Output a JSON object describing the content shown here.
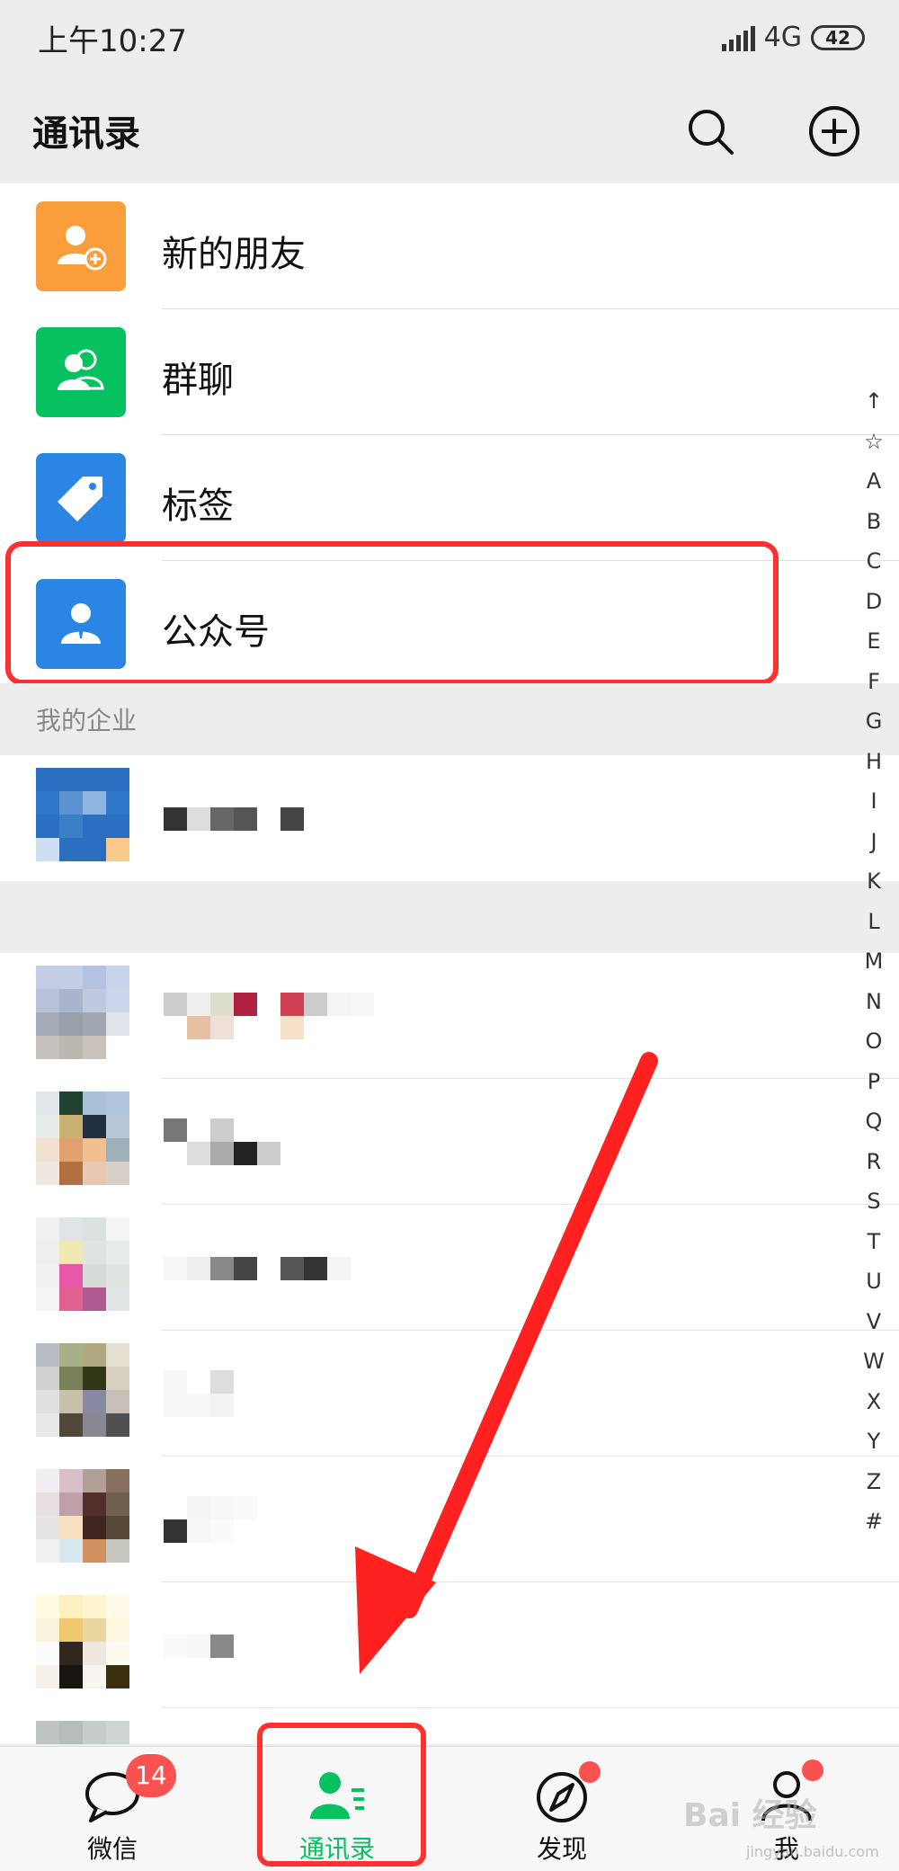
{
  "status_bar": {
    "time": "上午10:27",
    "network": "4G",
    "battery": "42"
  },
  "header": {
    "title": "通讯录",
    "search_icon": "search-icon",
    "add_icon": "plus-circle-icon"
  },
  "menu": [
    {
      "label": "新的朋友",
      "icon": "add-friend-icon",
      "color": "#fa9d3b"
    },
    {
      "label": "群聊",
      "icon": "group-icon",
      "color": "#07c160"
    },
    {
      "label": "标签",
      "icon": "tag-icon",
      "color": "#2b85e4"
    },
    {
      "label": "公众号",
      "icon": "official-account-icon",
      "color": "#2b85e4"
    }
  ],
  "sections": {
    "enterprise": "我的企业"
  },
  "index": [
    "↑",
    "☆",
    "A",
    "B",
    "C",
    "D",
    "E",
    "F",
    "G",
    "H",
    "I",
    "J",
    "K",
    "L",
    "M",
    "N",
    "O",
    "P",
    "Q",
    "R",
    "S",
    "T",
    "U",
    "V",
    "W",
    "X",
    "Y",
    "Z",
    "#"
  ],
  "tabs": [
    {
      "label": "微信",
      "icon": "chat-icon",
      "badge": "14"
    },
    {
      "label": "通讯录",
      "icon": "contacts-icon",
      "active": true
    },
    {
      "label": "发现",
      "icon": "discover-compass-icon",
      "dot": true
    },
    {
      "label": "我",
      "icon": "me-icon",
      "dot": true
    }
  ],
  "colors": {
    "accent": "#07c160",
    "badge": "#fa5151",
    "annotation": "#ff3030"
  },
  "watermark": {
    "text": "Bai 经验",
    "url_text": "jingyan.baidu.com"
  }
}
